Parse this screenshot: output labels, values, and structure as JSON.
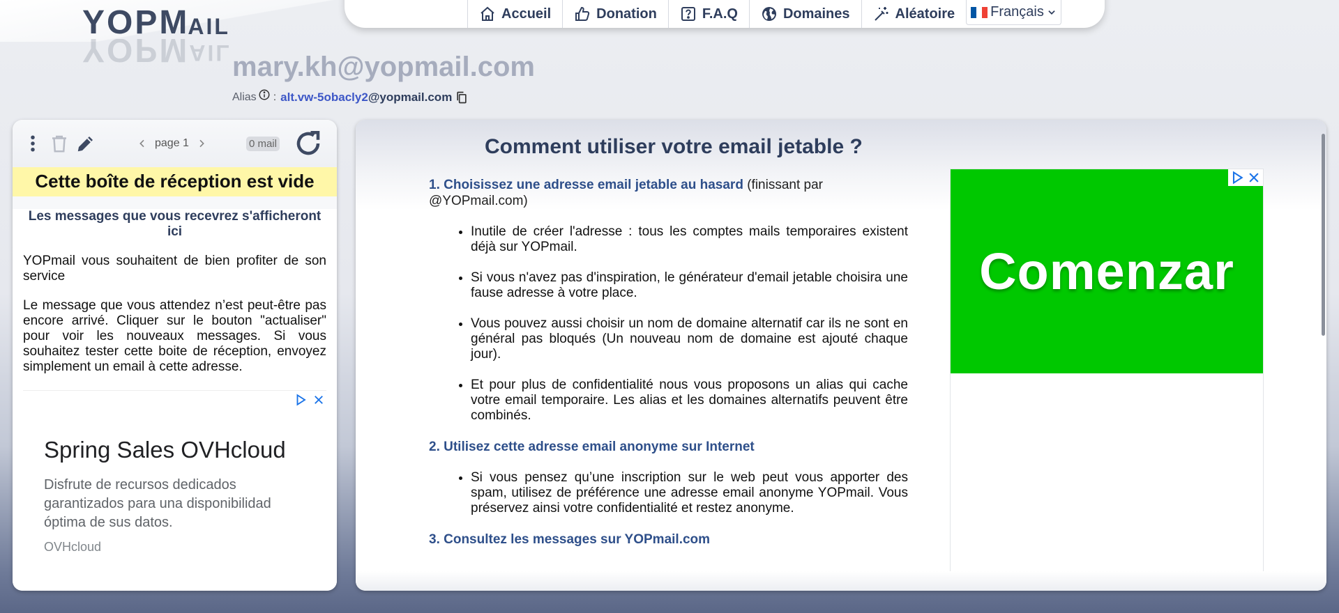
{
  "logo": {
    "text_main": "YOPM",
    "text_small": "AIL"
  },
  "nav": [
    {
      "label": "Accueil",
      "icon": "home-icon"
    },
    {
      "label": "Donation",
      "icon": "thumbs-up-icon"
    },
    {
      "label": "F.A.Q",
      "icon": "question-icon"
    },
    {
      "label": "Domaines",
      "icon": "globe-icon"
    },
    {
      "label": "Aléatoire",
      "icon": "magic-wand-icon"
    }
  ],
  "language": {
    "label": "Français",
    "flag_colors": [
      "#0055a4",
      "#ffffff",
      "#ef4135"
    ]
  },
  "email": "mary.kh@yopmail.com",
  "alias": {
    "label": "Alias",
    "separator": ":",
    "user": "alt.vw-5obacly2",
    "domain": "@yopmail.com"
  },
  "inbox": {
    "page_label": "page 1",
    "mail_count": "0 mail",
    "empty_banner": "Cette boîte de réception est vide",
    "subtitle": "Les messages que vous recevrez s'afficheront ici",
    "para1": "YOPmail vous souhaitent de bien profiter de son service",
    "para2": "Le message que vous attendez n’est peut-être pas encore arrivé. Cliquer sur le bouton \"actualiser\" pour voir les nouveaux messages. Si vous souhaitez tester cette boite de réception, envoyez simplement un email à cette adresse."
  },
  "ad_left": {
    "title": "Spring Sales OVHcloud",
    "desc": "Disfrute de recursos dedicados garantizados para una disponibilidad óptima de sus datos.",
    "source": "OVHcloud"
  },
  "guide": {
    "title": "Comment utiliser votre email jetable ?",
    "step1": {
      "heading": "1. Choisissez une adresse email jetable au hasard",
      "extra": " (finissant par @YOPmail.com)"
    },
    "step1_bullets": [
      "Inutile de créer l'adresse : tous les comptes mails temporaires existent déjà sur YOPmail.",
      "Si vous n'avez pas d'inspiration, le générateur d'email jetable choisira une fause adresse à votre place.",
      "Vous pouvez aussi choisir un nom de domaine alternatif car ils ne sont en général pas bloqués (Un nouveau nom de domaine est ajouté chaque jour).",
      "Et pour plus de confidentialité nous vous proposons un alias qui cache votre email temporaire. Les alias et les domaines alternatifs peuvent être combinés."
    ],
    "step2": {
      "heading": "2. Utilisez cette adresse email anonyme sur Internet"
    },
    "step2_bullets": [
      "Si vous pensez qu’une inscription sur le web peut vous apporter des spam, utilisez de préférence une adresse email anonyme YOPmail. Vous préservez ainsi votre confidentialité et restez anonyme."
    ],
    "step3": {
      "heading": "3. Consultez les messages sur YOPmail.com"
    }
  },
  "ad_right": {
    "cta": "Comenzar",
    "bg_color": "#00c800"
  }
}
